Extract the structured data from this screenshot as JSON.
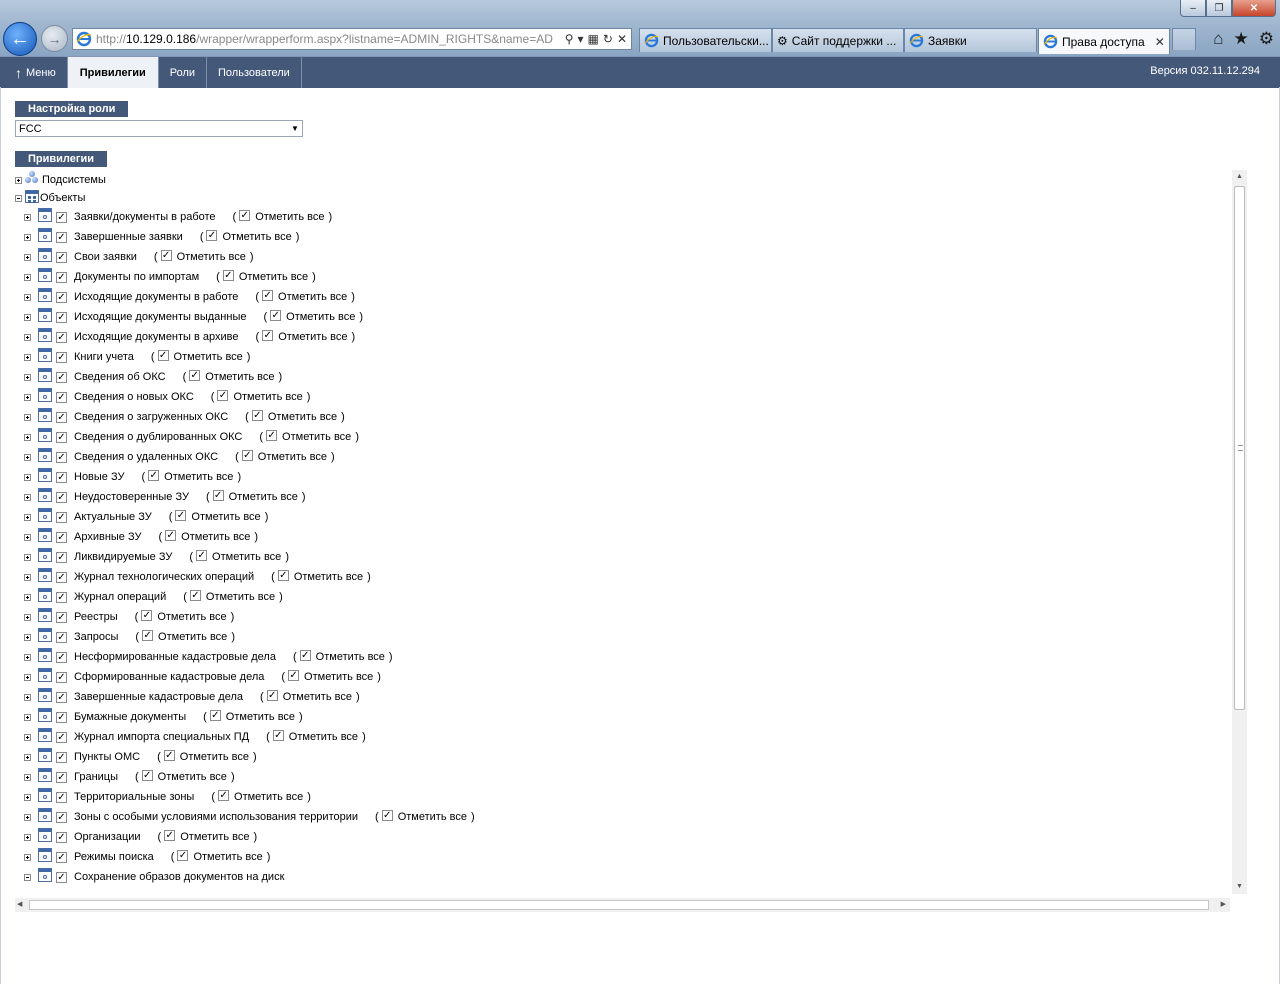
{
  "browser": {
    "url_prefix": "http://",
    "url_host": "10.129.0.186",
    "url_path": "/wrapper/wrapperform.aspx?listname=ADMIN_RIGHTS&name=AD",
    "tabs": [
      {
        "label": "Пользовательски..."
      },
      {
        "label": "Сайт поддержки ..."
      },
      {
        "label": "Заявки"
      },
      {
        "label": "Права доступа"
      }
    ]
  },
  "header": {
    "nav": {
      "menu": "Меню",
      "privileges": "Привилегии",
      "roles": "Роли",
      "users": "Пользователи"
    },
    "version": "Версия 032.11.12.294"
  },
  "role_section": {
    "title": "Настройка роли",
    "selected": "FCC"
  },
  "privileges_section": {
    "title": "Привилегии",
    "subsystems_label": "Подсистемы",
    "objects_label": "Объекты",
    "mark_all_label": "Отметить все",
    "items": [
      {
        "label": "Заявки/документы в работе",
        "has_mark_all": true
      },
      {
        "label": "Завершенные заявки",
        "has_mark_all": true
      },
      {
        "label": "Свои заявки",
        "has_mark_all": true
      },
      {
        "label": "Документы по импортам",
        "has_mark_all": true
      },
      {
        "label": "Исходящие документы в работе",
        "has_mark_all": true
      },
      {
        "label": "Исходящие документы выданные",
        "has_mark_all": true
      },
      {
        "label": "Исходящие документы в архиве",
        "has_mark_all": true
      },
      {
        "label": "Книги учета",
        "has_mark_all": true
      },
      {
        "label": "Сведения об ОКС",
        "has_mark_all": true
      },
      {
        "label": "Сведения о новых ОКС",
        "has_mark_all": true
      },
      {
        "label": "Сведения о загруженных ОКС",
        "has_mark_all": true
      },
      {
        "label": "Сведения о дублированных ОКС",
        "has_mark_all": true
      },
      {
        "label": "Сведения о удаленных ОКС",
        "has_mark_all": true
      },
      {
        "label": "Новые ЗУ",
        "has_mark_all": true
      },
      {
        "label": "Неудостоверенные ЗУ",
        "has_mark_all": true
      },
      {
        "label": "Актуальные ЗУ",
        "has_mark_all": true
      },
      {
        "label": "Архивные ЗУ",
        "has_mark_all": true
      },
      {
        "label": "Ликвидируемые ЗУ",
        "has_mark_all": true
      },
      {
        "label": "Журнал технологических операций",
        "has_mark_all": true
      },
      {
        "label": "Журнал операций",
        "has_mark_all": true
      },
      {
        "label": "Реестры",
        "has_mark_all": true
      },
      {
        "label": "Запросы",
        "has_mark_all": true
      },
      {
        "label": "Несформированные кадастровые дела",
        "has_mark_all": true
      },
      {
        "label": "Сформированные кадастровые дела",
        "has_mark_all": true
      },
      {
        "label": "Завершенные кадастровые дела",
        "has_mark_all": true
      },
      {
        "label": "Бумажные документы",
        "has_mark_all": true
      },
      {
        "label": "Журнал импорта специальных ПД",
        "has_mark_all": true
      },
      {
        "label": "Пункты ОМС",
        "has_mark_all": true
      },
      {
        "label": "Границы",
        "has_mark_all": true
      },
      {
        "label": "Территориальные зоны",
        "has_mark_all": true
      },
      {
        "label": "Зоны с особыми условиями использования территории",
        "has_mark_all": true
      },
      {
        "label": "Организации",
        "has_mark_all": true
      },
      {
        "label": "Режимы поиска",
        "has_mark_all": true
      },
      {
        "label": "Сохранение образов документов на диск",
        "has_mark_all": false
      }
    ]
  },
  "colors": {
    "header_bg": "#44597a",
    "section_bg": "#44597a"
  }
}
